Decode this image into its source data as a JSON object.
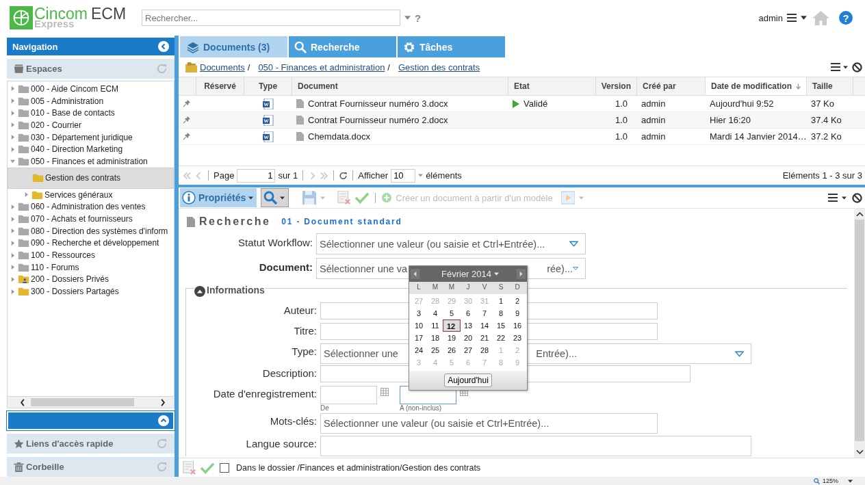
{
  "header": {
    "logo_name": "Cincom",
    "logo_product": "ECM",
    "logo_edition": "Express",
    "search_placeholder": "Rechercher...",
    "search_help": "?",
    "user": "admin",
    "help_button": "?"
  },
  "navigation": {
    "title": "Navigation",
    "spaces_title": "Espaces",
    "tree": [
      {
        "label": "000 - Aide Cincom ECM",
        "kind": "space",
        "expandable": true,
        "expanded": false,
        "selected": false
      },
      {
        "label": "005 - Administration",
        "kind": "space",
        "expandable": true,
        "expanded": false,
        "selected": false
      },
      {
        "label": "010 - Base de contacts",
        "kind": "space",
        "expandable": true,
        "expanded": false,
        "selected": false
      },
      {
        "label": "020 - Courrier",
        "kind": "space",
        "expandable": true,
        "expanded": false,
        "selected": false
      },
      {
        "label": "030 - Département juridique",
        "kind": "space",
        "expandable": true,
        "expanded": false,
        "selected": false
      },
      {
        "label": "040 - Direction Marketing",
        "kind": "space",
        "expandable": true,
        "expanded": false,
        "selected": false
      },
      {
        "label": "050 - Finances et administration",
        "kind": "space",
        "expandable": true,
        "expanded": true,
        "selected": false,
        "children": [
          {
            "label": "Gestion des contrats",
            "kind": "folder",
            "expandable": false,
            "expanded": false,
            "selected": true
          },
          {
            "label": "Services généraux",
            "kind": "folder",
            "expandable": true,
            "expanded": false,
            "selected": false
          }
        ]
      },
      {
        "label": "060 - Administration des ventes",
        "kind": "space",
        "expandable": true,
        "expanded": false,
        "selected": false
      },
      {
        "label": "070 - Achats et fournisseurs",
        "kind": "space",
        "expandable": true,
        "expanded": false,
        "selected": false
      },
      {
        "label": "080 - Direction des systèmes d'inform",
        "kind": "space",
        "expandable": true,
        "expanded": false,
        "selected": false
      },
      {
        "label": "090 - Recherche et développement",
        "kind": "space",
        "expandable": true,
        "expanded": false,
        "selected": false
      },
      {
        "label": "100 - Ressources",
        "kind": "space",
        "expandable": true,
        "expanded": false,
        "selected": false
      },
      {
        "label": "110 - Forums",
        "kind": "space",
        "expandable": true,
        "expanded": false,
        "selected": false
      },
      {
        "label": "200 - Dossiers Privés",
        "kind": "private",
        "expandable": true,
        "expanded": false,
        "selected": false
      },
      {
        "label": "300 - Dossiers Partagés",
        "kind": "folder",
        "expandable": true,
        "expanded": false,
        "selected": false
      }
    ],
    "quick_links": "Liens d'accès rapide",
    "trash": "Corbeille"
  },
  "tabs": [
    {
      "label": "Documents (3)",
      "kind": "documents",
      "selected": true
    },
    {
      "label": "Recherche",
      "kind": "search",
      "selected": false
    },
    {
      "label": "Tâches",
      "kind": "tasks",
      "selected": false
    }
  ],
  "breadcrumb": {
    "separator": "/",
    "items": [
      "Documents",
      "050 - Finances et administration",
      "Gestion des contrats"
    ]
  },
  "table": {
    "columns": [
      {
        "label": "Réservé",
        "sorted": false
      },
      {
        "label": "Type",
        "sorted": false
      },
      {
        "label": "Document",
        "sorted": false
      },
      {
        "label": "Etat",
        "sorted": false
      },
      {
        "label": "Version",
        "sorted": false
      },
      {
        "label": "Créé par",
        "sorted": false
      },
      {
        "label": "Date de modification",
        "sorted": true
      },
      {
        "label": "Taille",
        "sorted": false
      }
    ],
    "rows": [
      {
        "document": "Contrat Fournisseur numéro 3.docx",
        "status": "Validé",
        "version": "1.0",
        "author": "admin",
        "modified": "Aujourd'hui 9:52",
        "size": "37 Ko"
      },
      {
        "document": "Contrat Fournisseur numéro 2.docx",
        "version": "1.0",
        "author": "admin",
        "modified": "Hier 16:20",
        "size": "37.4 Ko"
      },
      {
        "document": "Chemdata.docx",
        "version": "1.0",
        "author": "admin",
        "modified": "Mardi 14 Janvier 2014…",
        "size": "37.2 Ko"
      }
    ]
  },
  "pager": {
    "page_label": "Page",
    "page": "1",
    "of_label": "sur 1",
    "show_label": "Afficher",
    "page_size": "10",
    "items_label": "éléments",
    "summary": "Eléments 1 - 3 sur 3"
  },
  "toolbar": {
    "properties": "Propriétés",
    "create_from_template": "Créer un document à partir d'un modèle"
  },
  "search_form": {
    "title": "Recherche",
    "doc_type": "01 - Document standard",
    "fields": [
      {
        "label": "Statut Workflow:",
        "kind": "select",
        "bold": false,
        "placeholder": "Sélectionner une valeur (ou saisie et Ctrl+Entrée)..."
      },
      {
        "label": "Document:",
        "kind": "select_split",
        "bold": true,
        "placeholder_start": "Sélectionner une va",
        "placeholder_end": "rée)..."
      }
    ],
    "section": "Informations",
    "section_fields": [
      {
        "label": "Auteur:",
        "kind": "text"
      },
      {
        "label": "Titre:",
        "kind": "text"
      },
      {
        "label": "Type:",
        "kind": "select_split",
        "placeholder_start": "Sélectionner une",
        "placeholder_end": "Entrée)..."
      },
      {
        "label": "Description:",
        "kind": "text_long"
      },
      {
        "label": "Date d'enregistrement:",
        "kind": "daterange",
        "from_label": "De",
        "to_label": "A (non-inclus)"
      },
      {
        "label": "Mots-clés:",
        "kind": "keywords",
        "placeholder": "Sélectionner une valeur (ou saisie et Ctrl+Entrée)..."
      },
      {
        "label": "Langue source:",
        "kind": "select_plain"
      }
    ]
  },
  "calendar": {
    "month": "Février 2014",
    "weekdays": [
      "L",
      "M",
      "M",
      "J",
      "V",
      "S",
      "D"
    ],
    "weeks": [
      [
        {
          "day": "27",
          "outside": true,
          "selected": false
        },
        {
          "day": "28",
          "outside": true,
          "selected": false
        },
        {
          "day": "29",
          "outside": true,
          "selected": false
        },
        {
          "day": "30",
          "outside": true,
          "selected": false
        },
        {
          "day": "31",
          "outside": true,
          "selected": false
        },
        {
          "day": "1",
          "outside": false,
          "selected": false
        },
        {
          "day": "2",
          "outside": false,
          "selected": false
        }
      ],
      [
        {
          "day": "3",
          "outside": false,
          "selected": false
        },
        {
          "day": "4",
          "outside": false,
          "selected": false
        },
        {
          "day": "5",
          "outside": false,
          "selected": false
        },
        {
          "day": "6",
          "outside": false,
          "selected": false
        },
        {
          "day": "7",
          "outside": false,
          "selected": false
        },
        {
          "day": "8",
          "outside": false,
          "selected": false
        },
        {
          "day": "9",
          "outside": false,
          "selected": false
        }
      ],
      [
        {
          "day": "10",
          "outside": false,
          "selected": false
        },
        {
          "day": "11",
          "outside": false,
          "selected": false
        },
        {
          "day": "12",
          "outside": false,
          "selected": true
        },
        {
          "day": "13",
          "outside": false,
          "selected": false
        },
        {
          "day": "14",
          "outside": false,
          "selected": false
        },
        {
          "day": "15",
          "outside": false,
          "selected": false
        },
        {
          "day": "16",
          "outside": false,
          "selected": false
        }
      ],
      [
        {
          "day": "17",
          "outside": false,
          "selected": false
        },
        {
          "day": "18",
          "outside": false,
          "selected": false
        },
        {
          "day": "19",
          "outside": false,
          "selected": false
        },
        {
          "day": "20",
          "outside": false,
          "selected": false
        },
        {
          "day": "21",
          "outside": false,
          "selected": false
        },
        {
          "day": "22",
          "outside": false,
          "selected": false
        },
        {
          "day": "23",
          "outside": false,
          "selected": false
        }
      ],
      [
        {
          "day": "24",
          "outside": false,
          "selected": false
        },
        {
          "day": "25",
          "outside": false,
          "selected": false
        },
        {
          "day": "26",
          "outside": false,
          "selected": false
        },
        {
          "day": "27",
          "outside": false,
          "selected": false
        },
        {
          "day": "28",
          "outside": false,
          "selected": false
        },
        {
          "day": "1",
          "outside": true,
          "selected": false
        },
        {
          "day": "2",
          "outside": true,
          "selected": false
        }
      ],
      [
        {
          "day": "3",
          "outside": true,
          "selected": false
        },
        {
          "day": "4",
          "outside": true,
          "selected": false
        },
        {
          "day": "5",
          "outside": true,
          "selected": false
        },
        {
          "day": "6",
          "outside": true,
          "selected": false
        },
        {
          "day": "7",
          "outside": true,
          "selected": false
        },
        {
          "day": "8",
          "outside": true,
          "selected": false
        },
        {
          "day": "9",
          "outside": true,
          "selected": false
        }
      ]
    ],
    "today_button": "Aujourd'hui"
  },
  "footer": {
    "folder_filter_checked": false,
    "folder_filter_label": "Dans le dossier /Finances et administration/Gestion des contrats"
  },
  "status_bar": {
    "zoom": "125%"
  }
}
